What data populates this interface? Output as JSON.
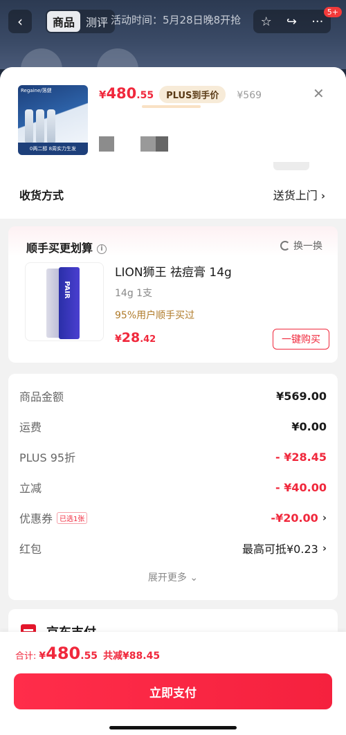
{
  "header": {
    "back_icon": "chevron-left-icon",
    "tabs": [
      {
        "label": "商品",
        "active": true
      },
      {
        "label": "测评",
        "active": false
      }
    ],
    "activity_text": "活动时间：5月28日晚8开抢",
    "icons": [
      "star-icon",
      "share-icon",
      "more-icon"
    ],
    "notification_count": "5+"
  },
  "product": {
    "image_brand": "Regaine/落健",
    "image_strip_text": "0两二醇 8周实力生发",
    "price": {
      "yen": "¥",
      "int": "480",
      "dec": ".55"
    },
    "plus_tag": "PLUS到手价",
    "original_price": "¥569"
  },
  "delivery": {
    "label": "收货方式",
    "value": "送货上门"
  },
  "upsell": {
    "title": "顺手买更划算",
    "swap_label": "换一换",
    "item": {
      "name": "LION狮王 祛痘膏 14g",
      "spec": "14g 1支",
      "social": "95%用户顺手买过",
      "price": {
        "yen": "¥",
        "int": "28",
        "dec": ".42"
      },
      "buy_label": "一键购买",
      "tube_text": "PAIR"
    }
  },
  "summary": {
    "rows": [
      {
        "label": "商品金额",
        "value": "¥569.00"
      },
      {
        "label": "运费",
        "value": "¥0.00"
      },
      {
        "label": "PLUS 95折",
        "value": "- ¥28.45"
      },
      {
        "label": "立减",
        "value": "- ¥40.00"
      },
      {
        "label": "优惠券",
        "badge": "已选1张",
        "value": "-¥20.00"
      },
      {
        "label": "红包",
        "value": "最高可抵¥0.23"
      }
    ],
    "expand_label": "展开更多 ⌄"
  },
  "payment": {
    "label": "京东支付"
  },
  "footer": {
    "total_label": "合计:",
    "total": {
      "yen": "¥",
      "int": "480",
      "dec": ".55"
    },
    "saved": "共减¥88.45",
    "pay_button": "立即支付"
  },
  "colors": {
    "accent": "#f0283c",
    "plus_bg": "#f7ebd8",
    "social": "#b07b2a"
  }
}
